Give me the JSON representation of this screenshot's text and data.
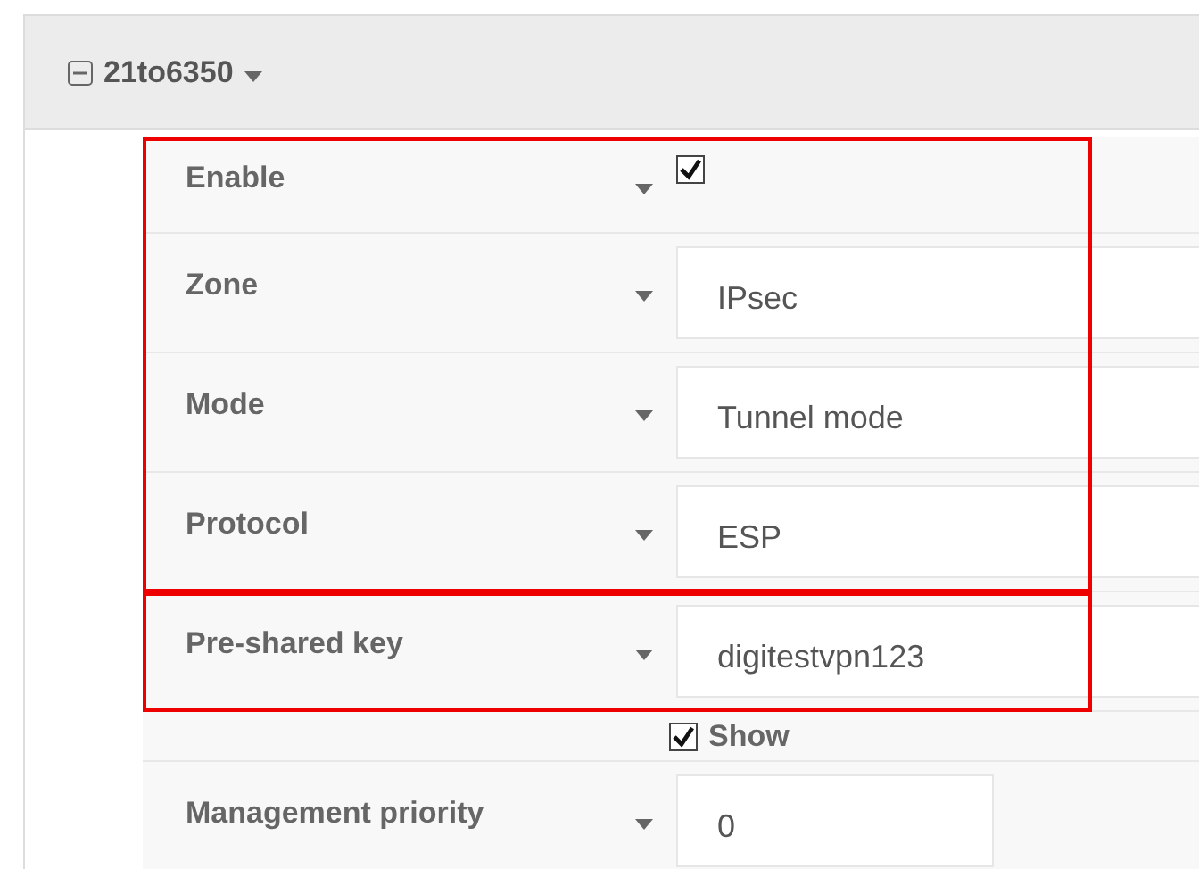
{
  "group": {
    "title": "21to6350",
    "expanded": true
  },
  "sections": [
    {
      "highlighted": true,
      "rows": [
        {
          "kind": "checkbox",
          "label": "Enable",
          "checked": true
        },
        {
          "kind": "input",
          "label": "Zone",
          "value": "IPsec"
        },
        {
          "kind": "input",
          "label": "Mode",
          "value": "Tunnel mode"
        },
        {
          "kind": "input",
          "label": "Protocol",
          "value": "ESP"
        }
      ]
    },
    {
      "highlighted": true,
      "rows": [
        {
          "kind": "input",
          "label": "Pre-shared key",
          "value": "digitestvpn123"
        }
      ]
    },
    {
      "highlighted": false,
      "rows": [
        {
          "kind": "option",
          "label": "Show",
          "checked": true
        },
        {
          "kind": "short-input",
          "label": "Management priority",
          "value": "0"
        }
      ]
    }
  ]
}
